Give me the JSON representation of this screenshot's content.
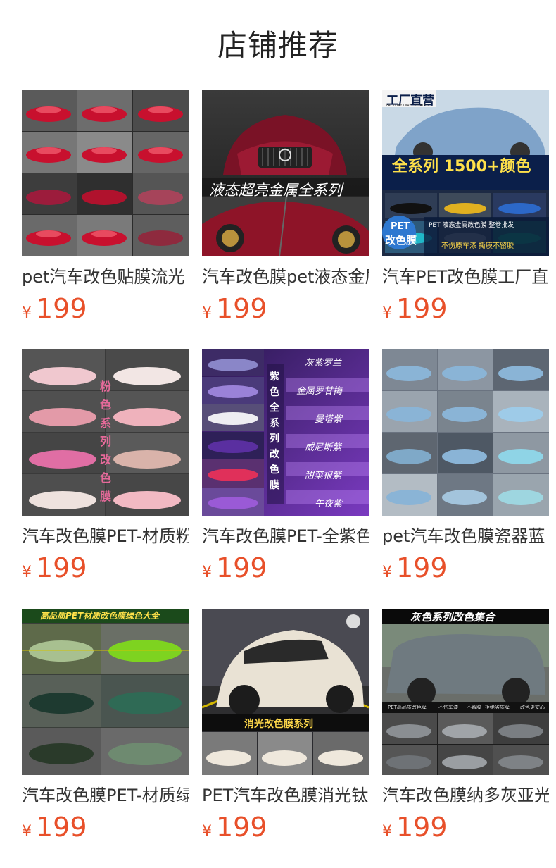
{
  "page_title": "店铺推荐",
  "products": [
    {
      "name": "pet汽车改色贴膜流光",
      "currency": "¥",
      "price": "199",
      "overlay": []
    },
    {
      "name": "汽车改色膜pet液态金属全系列",
      "currency": "¥",
      "price": "199",
      "overlay": [
        "液态超亮金属全系列"
      ]
    },
    {
      "name": "汽车PET改色膜工厂直营",
      "currency": "¥",
      "price": "199",
      "overlay": [
        "工厂直营",
        "FACTORY DIRECT SALES",
        "全系列 1500+颜色",
        "PET",
        "改色膜",
        "PET 液态金属改色膜 整卷批发",
        "不伤原车漆 撕膜不留胶"
      ]
    },
    {
      "name": "汽车改色膜PET-材质粉色",
      "currency": "¥",
      "price": "199",
      "overlay": [
        "粉色系列改色膜"
      ]
    },
    {
      "name": "汽车改色膜PET-全紫色系列",
      "currency": "¥",
      "price": "199",
      "overlay": [
        "紫色全系列改色膜",
        "灰紫罗兰",
        "金属罗甘梅",
        "曼塔紫",
        "威尼斯紫",
        "甜菜根紫",
        "午夜紫"
      ]
    },
    {
      "name": "pet汽车改色膜瓷器蓝",
      "currency": "¥",
      "price": "199",
      "overlay": []
    },
    {
      "name": "汽车改色膜PET-材质绿色",
      "currency": "¥",
      "price": "199",
      "overlay": [
        "高品质PET材质改色膜绿色大全"
      ]
    },
    {
      "name": "PET汽车改色膜消光钛",
      "currency": "¥",
      "price": "199",
      "overlay": [
        "消光改色膜系列"
      ]
    },
    {
      "name": "汽车改色膜纳多灰亚光",
      "currency": "¥",
      "price": "199",
      "overlay": [
        "灰色系列改色集合",
        "PET高品质改色膜",
        "不伤车漆",
        "不留胶",
        "拒绝劣质膜",
        "改色更安心"
      ]
    }
  ],
  "colors": {
    "price": "#e8502a",
    "title": "#222222"
  }
}
